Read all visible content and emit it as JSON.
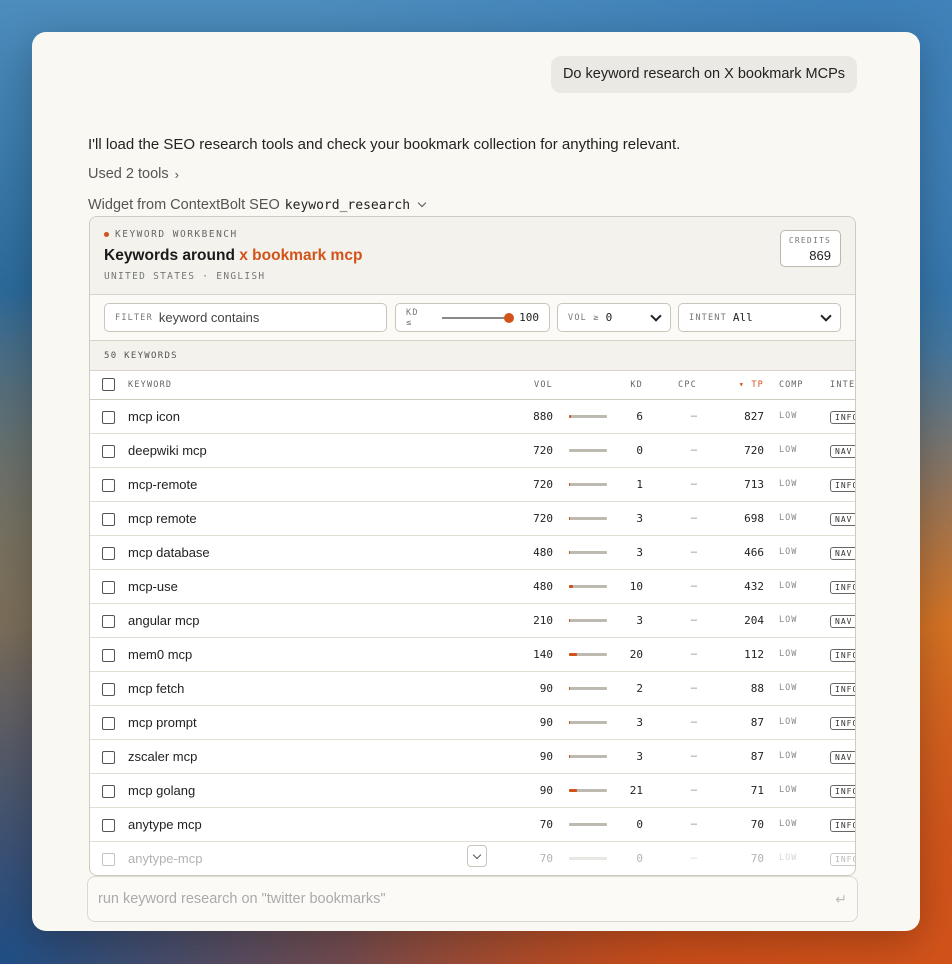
{
  "chat": {
    "user_message": "Do keyword research on X bookmark MCPs",
    "assistant_message": "I'll load the SEO research tools and check your bookmark collection for anything relevant.",
    "used_tools": "Used 2 tools",
    "widget_source_prefix": "Widget from ContextBolt SEO",
    "widget_tool_name": "keyword_research"
  },
  "widget": {
    "kicker": "KEYWORD WORKBENCH",
    "title_prefix": "Keywords around",
    "title_topic": "x bookmark mcp",
    "location": "UNITED STATES · ENGLISH",
    "credits_label": "CREDITS",
    "credits_value": "869",
    "accent_color": "#d2531a",
    "filters": {
      "filter_label": "FILTER",
      "filter_placeholder": "keyword contains",
      "kd_label": "KD ≤",
      "kd_value": "100",
      "kd_max_fraction": 1.0,
      "vol_label": "VOL ≥",
      "vol_value": "0",
      "intent_label": "INTENT",
      "intent_value": "All"
    },
    "count_label": "50 KEYWORDS",
    "columns": {
      "keyword": "KEYWORD",
      "vol": "VOL",
      "kd": "KD",
      "cpc": "CPC",
      "tp": "▾ TP",
      "comp": "COMP",
      "intent": "INTENT"
    },
    "rows": [
      {
        "keyword": "mcp icon",
        "vol": "880",
        "kd": "6",
        "cpc": "–",
        "tp": "827",
        "comp": "LOW",
        "intent": "INFO"
      },
      {
        "keyword": "deepwiki mcp",
        "vol": "720",
        "kd": "0",
        "cpc": "–",
        "tp": "720",
        "comp": "LOW",
        "intent": "NAV"
      },
      {
        "keyword": "mcp-remote",
        "vol": "720",
        "kd": "1",
        "cpc": "–",
        "tp": "713",
        "comp": "LOW",
        "intent": "INFO"
      },
      {
        "keyword": "mcp remote",
        "vol": "720",
        "kd": "3",
        "cpc": "–",
        "tp": "698",
        "comp": "LOW",
        "intent": "NAV"
      },
      {
        "keyword": "mcp database",
        "vol": "480",
        "kd": "3",
        "cpc": "–",
        "tp": "466",
        "comp": "LOW",
        "intent": "NAV"
      },
      {
        "keyword": "mcp-use",
        "vol": "480",
        "kd": "10",
        "cpc": "–",
        "tp": "432",
        "comp": "LOW",
        "intent": "INFO"
      },
      {
        "keyword": "angular mcp",
        "vol": "210",
        "kd": "3",
        "cpc": "–",
        "tp": "204",
        "comp": "LOW",
        "intent": "NAV"
      },
      {
        "keyword": "mem0 mcp",
        "vol": "140",
        "kd": "20",
        "cpc": "–",
        "tp": "112",
        "comp": "LOW",
        "intent": "INFO"
      },
      {
        "keyword": "mcp fetch",
        "vol": "90",
        "kd": "2",
        "cpc": "–",
        "tp": "88",
        "comp": "LOW",
        "intent": "INFO"
      },
      {
        "keyword": "mcp prompt",
        "vol": "90",
        "kd": "3",
        "cpc": "–",
        "tp": "87",
        "comp": "LOW",
        "intent": "INFO"
      },
      {
        "keyword": "zscaler mcp",
        "vol": "90",
        "kd": "3",
        "cpc": "–",
        "tp": "87",
        "comp": "LOW",
        "intent": "NAV"
      },
      {
        "keyword": "mcp golang",
        "vol": "90",
        "kd": "21",
        "cpc": "–",
        "tp": "71",
        "comp": "LOW",
        "intent": "INFO"
      },
      {
        "keyword": "anytype mcp",
        "vol": "70",
        "kd": "0",
        "cpc": "–",
        "tp": "70",
        "comp": "LOW",
        "intent": "INFO"
      },
      {
        "keyword": "anytype-mcp",
        "vol": "70",
        "kd": "0",
        "cpc": "–",
        "tp": "70",
        "comp": "LOW",
        "intent": "INFO"
      }
    ]
  },
  "composer": {
    "placeholder": "run keyword research on \"twitter bookmarks\"",
    "enter_icon": "↵"
  }
}
